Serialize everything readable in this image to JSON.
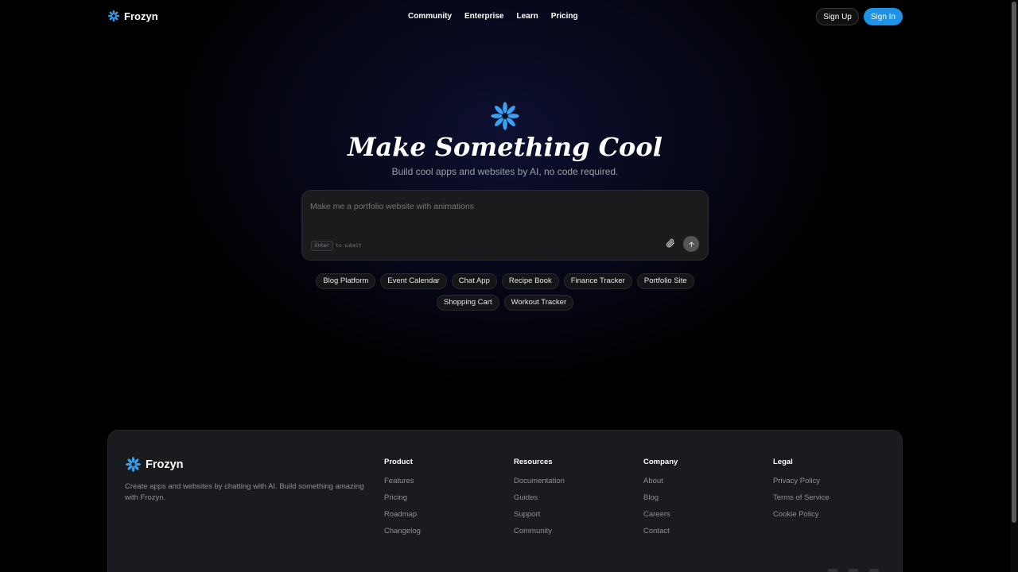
{
  "nav": {
    "brand": "Frozyn",
    "links": [
      "Community",
      "Enterprise",
      "Learn",
      "Pricing"
    ],
    "sign_up": "Sign Up",
    "sign_in": "Sign In"
  },
  "hero": {
    "title": "Make Something Cool",
    "subtitle": "Build cool apps and websites by AI, no code required.",
    "prompt_placeholder": "Make me a portfolio website with animations",
    "kbd_key": "Enter",
    "kbd_hint": "to submit"
  },
  "chips": [
    "Blog Platform",
    "Event Calendar",
    "Chat App",
    "Recipe Book",
    "Finance Tracker",
    "Portfolio Site",
    "Shopping Cart",
    "Workout Tracker"
  ],
  "footer": {
    "brand": "Frozyn",
    "description": "Create apps and websites by chatting with AI. Build something amazing with Frozyn.",
    "columns": [
      {
        "title": "Product",
        "links": [
          "Features",
          "Pricing",
          "Roadmap",
          "Changelog"
        ]
      },
      {
        "title": "Resources",
        "links": [
          "Documentation",
          "Guides",
          "Support",
          "Community"
        ]
      },
      {
        "title": "Company",
        "links": [
          "About",
          "Blog",
          "Careers",
          "Contact"
        ]
      },
      {
        "title": "Legal",
        "links": [
          "Privacy Policy",
          "Terms of Service",
          "Cookie Policy"
        ]
      }
    ]
  },
  "colors": {
    "accent": "#1e93e6",
    "logo_blue": "#3aa0f0",
    "background": "#000000",
    "footer_bg": "#1a1b1e"
  },
  "icons": {
    "brand": "flower-logo-icon",
    "attach": "paperclip-icon",
    "send": "arrow-up-icon"
  }
}
